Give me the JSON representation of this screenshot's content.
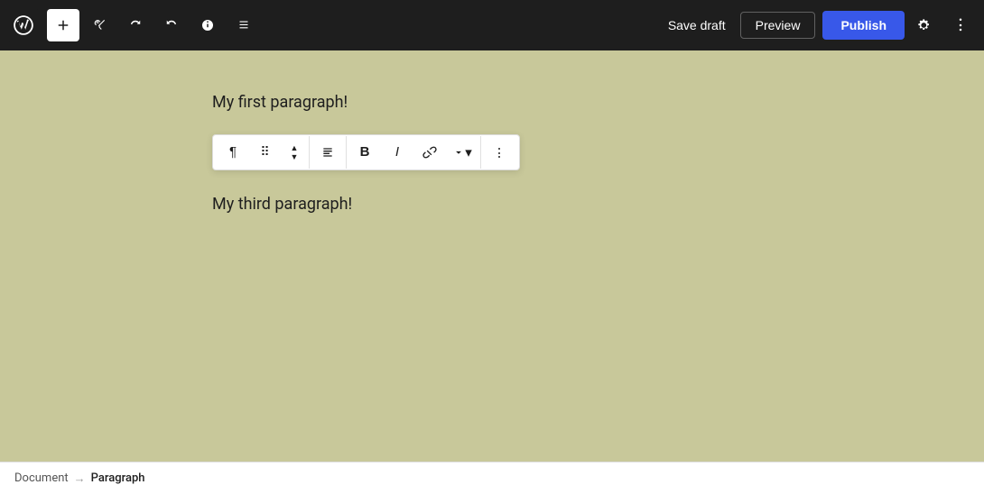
{
  "toolbar": {
    "wp_logo_alt": "WordPress",
    "add_label": "+",
    "tools_label": "Tools",
    "undo_label": "Undo",
    "redo_label": "Redo",
    "info_label": "Details",
    "list_view_label": "List View",
    "save_draft_label": "Save draft",
    "preview_label": "Preview",
    "publish_label": "Publish",
    "settings_label": "Settings",
    "more_label": "Options"
  },
  "editor": {
    "paragraph1": "My first paragraph!",
    "paragraph3": "My third paragraph!"
  },
  "block_toolbar": {
    "paragraph_icon": "¶",
    "drag_icon": "⠿",
    "move_up": "▲",
    "move_down": "▼",
    "align_label": "≡",
    "bold_label": "B",
    "italic_label": "I",
    "link_label": "⌁",
    "more_label": "▾",
    "options_label": "⋮"
  },
  "statusbar": {
    "document_label": "Document",
    "arrow": "→",
    "paragraph_label": "Paragraph"
  }
}
